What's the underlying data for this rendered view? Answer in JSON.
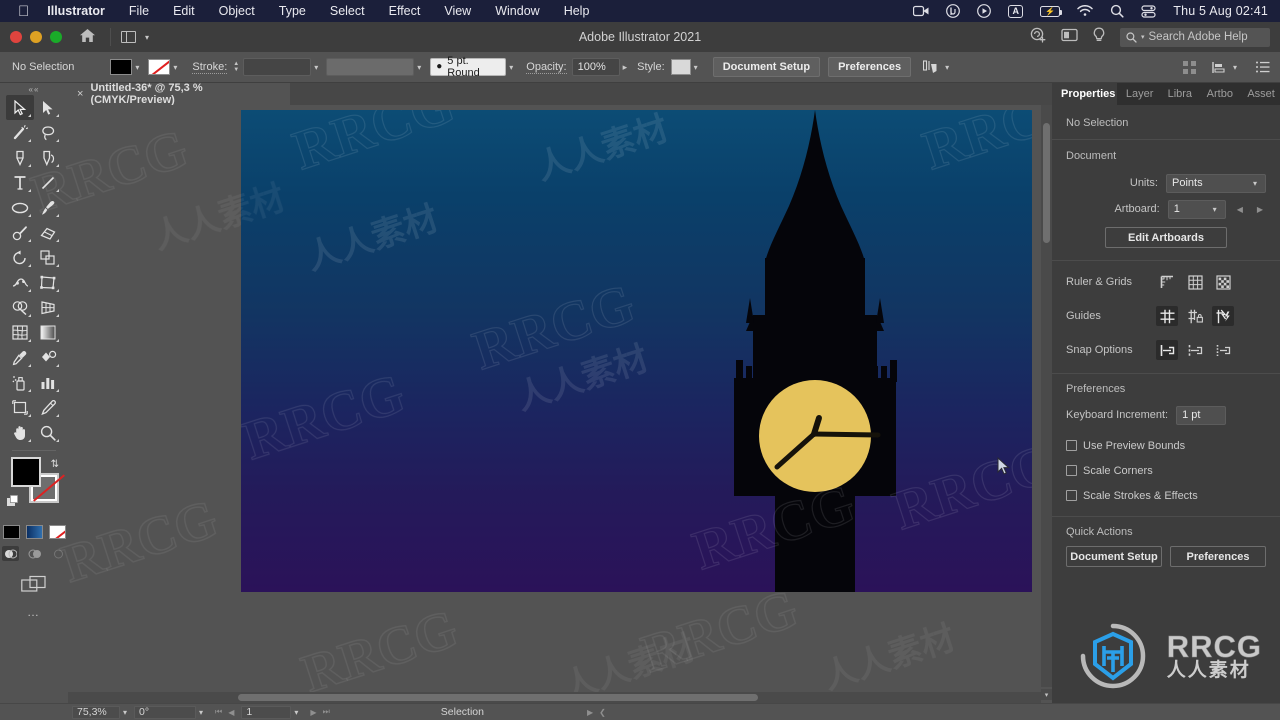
{
  "menubar": {
    "apple": "apple-logo",
    "items": [
      {
        "label": "Illustrator",
        "bold": true
      },
      {
        "label": "File"
      },
      {
        "label": "Edit"
      },
      {
        "label": "Object"
      },
      {
        "label": "Type"
      },
      {
        "label": "Select"
      },
      {
        "label": "Effect"
      },
      {
        "label": "View"
      },
      {
        "label": "Window"
      },
      {
        "label": "Help"
      }
    ],
    "status_icons": [
      "screen-record-icon",
      "utorrent-icon",
      "play-circle-icon",
      "input-source-A-icon",
      "battery-charging-icon",
      "wifi-icon",
      "spotlight-search-icon",
      "control-center-icon"
    ],
    "input_source": "A",
    "clock": "Thu 5 Aug  02:41"
  },
  "appbar": {
    "title": "Adobe Illustrator 2021",
    "home_icon": "home-icon",
    "arrange_icon": "arrange-documents-icon",
    "chevron": "⌄",
    "cloud_icon": "cloud-user-icon",
    "screen_icon": "screen-mode-icon",
    "bulb_icon": "discover-bulb-icon",
    "search_placeholder": "Search Adobe Help",
    "search_icon": "search-icon"
  },
  "controlbar": {
    "selection_state": "No Selection",
    "fill_swatch": "#000000",
    "stroke_swatch": "none",
    "stroke_label": "Stroke:",
    "stroke_weight": "",
    "stroke_profile": "",
    "brush_label": "5 pt. Round",
    "opacity_label": "Opacity:",
    "opacity_value": "100%",
    "style_label": "Style:",
    "document_setup": "Document Setup",
    "preferences": "Preferences",
    "align_icon": "align-selection-icon",
    "grid_icon": "grid-icon",
    "distribute_icon": "distribute-icon",
    "more_icon": "more-options-icon"
  },
  "doctab": {
    "close_icon": "×",
    "label": "Untitled-36* @ 75,3 % (CMYK/Preview)"
  },
  "toolbar": {
    "handle": "««",
    "tools": [
      {
        "name": "selection-tool",
        "glyph": "selection",
        "active": true
      },
      {
        "name": "direct-selection-tool",
        "glyph": "direct"
      },
      {
        "name": "magic-wand-tool",
        "glyph": "wand"
      },
      {
        "name": "lasso-tool",
        "glyph": "lasso"
      },
      {
        "name": "pen-tool",
        "glyph": "pen"
      },
      {
        "name": "curvature-tool",
        "glyph": "curvature"
      },
      {
        "name": "type-tool",
        "glyph": "type"
      },
      {
        "name": "line-segment-tool",
        "glyph": "line"
      },
      {
        "name": "ellipse-tool",
        "glyph": "ellipse"
      },
      {
        "name": "paintbrush-tool",
        "glyph": "brush"
      },
      {
        "name": "shaper-tool",
        "glyph": "shaper"
      },
      {
        "name": "eraser-tool",
        "glyph": "eraser"
      },
      {
        "name": "rotate-tool",
        "glyph": "rotate"
      },
      {
        "name": "scale-tool",
        "glyph": "scale"
      },
      {
        "name": "width-tool",
        "glyph": "width"
      },
      {
        "name": "free-transform-tool",
        "glyph": "freetransform"
      },
      {
        "name": "shape-builder-tool",
        "glyph": "shapebuilder"
      },
      {
        "name": "perspective-grid-tool",
        "glyph": "perspective"
      },
      {
        "name": "mesh-tool",
        "glyph": "mesh"
      },
      {
        "name": "gradient-tool",
        "glyph": "gradient"
      },
      {
        "name": "eyedropper-tool",
        "glyph": "eyedropper"
      },
      {
        "name": "blend-tool",
        "glyph": "blend"
      },
      {
        "name": "symbol-sprayer-tool",
        "glyph": "sprayer"
      },
      {
        "name": "column-graph-tool",
        "glyph": "graph"
      },
      {
        "name": "artboard-tool",
        "glyph": "artboard"
      },
      {
        "name": "slice-tool",
        "glyph": "slice"
      },
      {
        "name": "hand-tool",
        "glyph": "hand"
      },
      {
        "name": "zoom-tool",
        "glyph": "zoom"
      }
    ],
    "fill_color": "#000000",
    "stroke_color": "none",
    "swap_icon": "swap-fill-stroke-icon",
    "default_icon": "default-fill-stroke-icon",
    "color_modes": [
      "color-swatch",
      "gradient-swatch",
      "none-swatch"
    ],
    "draw_modes": [
      "draw-normal",
      "draw-behind",
      "draw-inside"
    ],
    "screen_mode_icon": "change-screen-mode-icon",
    "edit_toolbar_icon": "edit-toolbar-icon"
  },
  "panel": {
    "tabs": [
      {
        "label": "Properties",
        "selected": true
      },
      {
        "label": "Layer",
        "selected": false
      },
      {
        "label": "Libra",
        "selected": false
      },
      {
        "label": "Artbo",
        "selected": false
      },
      {
        "label": "Asset",
        "selected": false
      }
    ],
    "selection_state": "No Selection",
    "document": {
      "heading": "Document",
      "units_label": "Units:",
      "units_value": "Points",
      "artboard_label": "Artboard:",
      "artboard_value": "1",
      "prev_icon": "prev-artboard-icon",
      "next_icon": "next-artboard-icon",
      "edit_artboards": "Edit Artboards"
    },
    "ruler_grids": {
      "label": "Ruler & Grids",
      "icons": [
        "show-rulers-icon",
        "show-grid-icon",
        "show-transparency-grid-icon"
      ]
    },
    "guides": {
      "label": "Guides",
      "icons": [
        "show-guides-icon",
        "lock-guides-icon",
        "smart-guides-icon"
      ],
      "active_index": 2
    },
    "snap_options": {
      "label": "Snap Options",
      "icons": [
        "snap-to-point-icon",
        "snap-to-grid-icon",
        "snap-to-pixel-icon"
      ],
      "active_index": 0
    },
    "preferences": {
      "heading": "Preferences",
      "keyboard_increment_label": "Keyboard Increment:",
      "keyboard_increment_value": "1 pt",
      "checkboxes": [
        {
          "label": "Use Preview Bounds",
          "checked": false
        },
        {
          "label": "Scale Corners",
          "checked": false
        },
        {
          "label": "Scale Strokes & Effects",
          "checked": false
        }
      ]
    },
    "quick_actions": {
      "heading": "Quick Actions",
      "buttons": [
        "Document Setup",
        "Preferences"
      ]
    }
  },
  "statusbar": {
    "zoom": "75,3%",
    "rotation": "0°",
    "artboard_number": "1",
    "tool": "Selection",
    "first_icon": "first-artboard-icon",
    "prev_icon": "prev-artboard-icon",
    "next_icon": "next-artboard-icon",
    "last_icon": "last-artboard-icon"
  },
  "artwork": {
    "description": "Big Ben clock tower silhouette at night",
    "sky_top": "#0c4c75",
    "sky_bottom": "#2b1259",
    "tower_color": "#050508",
    "clock_face": "#e5c35c",
    "hand_color": "#15120a"
  },
  "watermark": {
    "text_latin": "RRCG",
    "text_cn": "人人素材",
    "logo_title": "RRCG",
    "logo_subtitle": "人人素材"
  }
}
